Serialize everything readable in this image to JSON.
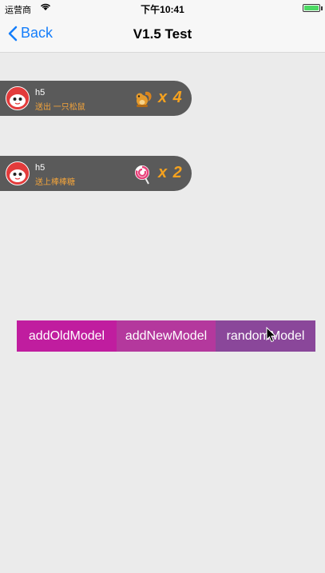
{
  "status_bar": {
    "carrier": "运营商",
    "time": "下午10:41"
  },
  "nav": {
    "back_label": "Back",
    "title": "V1.5 Test"
  },
  "gifts": [
    {
      "user": "h5",
      "message": "送出 一只松鼠",
      "count": "x 4",
      "icon": "squirrel-icon"
    },
    {
      "user": "h5",
      "message": "送上棒棒糖",
      "count": "x 2",
      "icon": "lollipop-icon"
    }
  ],
  "buttons": {
    "add_old": "addOldModel",
    "add_new": "addNewModel",
    "random": "randomModel"
  },
  "colors": {
    "accent": "#147efb",
    "gift_bg": "#5a5a5a",
    "gift_text": "#f3a43b",
    "btn_old": "#c01d9f",
    "btn_new": "#b4389d",
    "btn_random": "#8a479a"
  }
}
